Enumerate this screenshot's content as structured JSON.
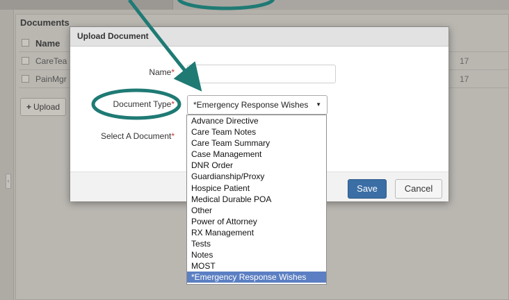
{
  "panel": {
    "title": "Documents",
    "column_name": "Name",
    "rows": [
      {
        "name": "CareTea",
        "right": "17"
      },
      {
        "name": "PainMgr",
        "right": "17"
      }
    ],
    "upload_label": "Upload"
  },
  "modal": {
    "title": "Upload Document",
    "name_label": "Name",
    "doc_type_label": "Document Type",
    "select_doc_label": "Select A Document",
    "required_mark": "*",
    "name_value": "",
    "doc_type_value": "*Emergency Response Wishes",
    "save_label": "Save",
    "cancel_label": "Cancel"
  },
  "dropdown": {
    "options": [
      "Advance Directive",
      "Care Team Notes",
      "Care Team Summary",
      "Case Management",
      "DNR Order",
      "Guardianship/Proxy",
      "Hospice Patient",
      "Medical Durable POA",
      "Other",
      "Power of Attorney",
      "RX Management",
      "Tests",
      "Notes",
      "MOST",
      "*Emergency Response Wishes"
    ],
    "selected": "*Emergency Response Wishes"
  },
  "colors": {
    "annotation": "#1f7a74",
    "selected_option": "#5b7fc2",
    "save_button": "#3a6ea5",
    "required": "#c0392b"
  },
  "icons": {
    "upload": "plus-icon",
    "select": "caret-down-icon"
  }
}
